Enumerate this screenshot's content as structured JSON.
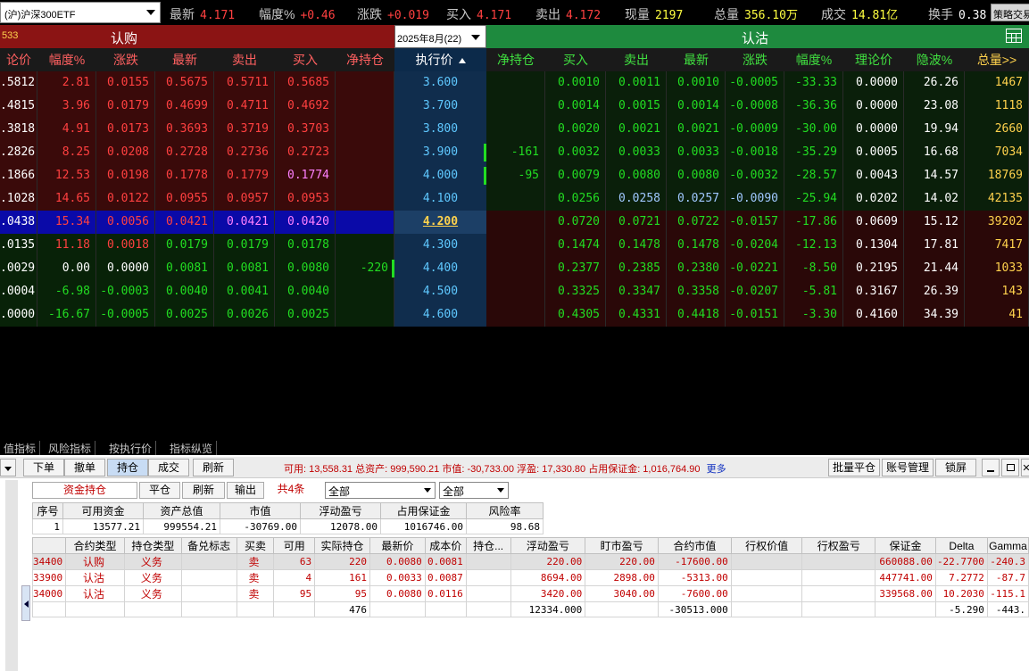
{
  "topbar": {
    "instrument": "(沪)沪深300ETF",
    "quotes": [
      {
        "label": "最新",
        "value": "4.171",
        "color": "red"
      },
      {
        "label": "幅度%",
        "value": "+0.46",
        "color": "red"
      },
      {
        "label": "涨跌",
        "value": "+0.019",
        "color": "red"
      },
      {
        "label": "买入",
        "value": "4.171",
        "color": "red"
      },
      {
        "label": "卖出",
        "value": "4.172",
        "color": "red"
      },
      {
        "label": "现量",
        "value": "2197",
        "color": "yel"
      },
      {
        "label": "总量",
        "value": "356.10万",
        "color": "yel"
      },
      {
        "label": "成交",
        "value": "14.81亿",
        "color": "yel"
      },
      {
        "label": "换手",
        "value": "0.38",
        "color": "wht"
      }
    ],
    "strategy_button": "策略交易"
  },
  "section": {
    "call_title": "认购",
    "call_num": "533",
    "month": "2025年8月(22)",
    "put_title": "认沽"
  },
  "columns": {
    "call": [
      "论价",
      "幅度%",
      "涨跌",
      "最新",
      "卖出",
      "买入",
      "净持仓"
    ],
    "strike": "执行价",
    "put": [
      "净持仓",
      "买入",
      "卖出",
      "最新",
      "涨跌",
      "幅度%",
      "理论价",
      "隐波%",
      "总量>>"
    ]
  },
  "rows": [
    {
      "call": [
        ".5812",
        "2.81",
        "0.0155",
        "0.5675",
        "0.5711",
        "0.5685",
        ""
      ],
      "strike": "3.600",
      "put": [
        "",
        "0.0010",
        "0.0011",
        "0.0010",
        "-0.0005",
        "-33.33",
        "0.0000",
        "26.26",
        "1467"
      ]
    },
    {
      "call": [
        ".4815",
        "3.96",
        "0.0179",
        "0.4699",
        "0.4711",
        "0.4692",
        ""
      ],
      "strike": "3.700",
      "put": [
        "",
        "0.0014",
        "0.0015",
        "0.0014",
        "-0.0008",
        "-36.36",
        "0.0000",
        "23.08",
        "1118"
      ]
    },
    {
      "call": [
        ".3818",
        "4.91",
        "0.0173",
        "0.3693",
        "0.3719",
        "0.3703",
        ""
      ],
      "strike": "3.800",
      "put": [
        "",
        "0.0020",
        "0.0021",
        "0.0021",
        "-0.0009",
        "-30.00",
        "0.0000",
        "19.94",
        "2660"
      ]
    },
    {
      "call": [
        ".2826",
        "8.25",
        "0.0208",
        "0.2728",
        "0.2736",
        "0.2723",
        ""
      ],
      "strike": "3.900",
      "put": [
        "-161",
        "0.0032",
        "0.0033",
        "0.0033",
        "-0.0018",
        "-35.29",
        "0.0005",
        "16.68",
        "7034"
      ]
    },
    {
      "call": [
        ".1866",
        "12.53",
        "0.0198",
        "0.1778",
        "0.1779",
        "0.1774",
        ""
      ],
      "strike": "4.000",
      "put": [
        "-95",
        "0.0079",
        "0.0080",
        "0.0080",
        "-0.0032",
        "-28.57",
        "0.0043",
        "14.57",
        "18769"
      ]
    },
    {
      "call": [
        ".1028",
        "14.65",
        "0.0122",
        "0.0955",
        "0.0957",
        "0.0953",
        ""
      ],
      "strike": "4.100",
      "put": [
        "",
        "0.0256",
        "0.0258",
        "0.0257",
        "-0.0090",
        "-25.94",
        "0.0202",
        "14.02",
        "42135"
      ]
    },
    {
      "call": [
        ".0438",
        "15.34",
        "0.0056",
        "0.0421",
        "0.0421",
        "0.0420",
        ""
      ],
      "strike": "4.200",
      "put": [
        "",
        "0.0720",
        "0.0721",
        "0.0722",
        "-0.0157",
        "-17.86",
        "0.0609",
        "15.12",
        "39202"
      ]
    },
    {
      "call": [
        ".0135",
        "11.18",
        "0.0018",
        "0.0179",
        "0.0179",
        "0.0178",
        ""
      ],
      "strike": "4.300",
      "put": [
        "",
        "0.1474",
        "0.1478",
        "0.1478",
        "-0.0204",
        "-12.13",
        "0.1304",
        "17.81",
        "7417"
      ]
    },
    {
      "call": [
        ".0029",
        "0.00",
        "0.0000",
        "0.0081",
        "0.0081",
        "0.0080",
        "-220"
      ],
      "strike": "4.400",
      "put": [
        "",
        "0.2377",
        "0.2385",
        "0.2380",
        "-0.0221",
        "-8.50",
        "0.2195",
        "21.44",
        "1033"
      ]
    },
    {
      "call": [
        ".0004",
        "-6.98",
        "-0.0003",
        "0.0040",
        "0.0041",
        "0.0040",
        ""
      ],
      "strike": "4.500",
      "put": [
        "",
        "0.3325",
        "0.3347",
        "0.3358",
        "-0.0207",
        "-5.81",
        "0.3167",
        "26.39",
        "143"
      ]
    },
    {
      "call": [
        ".0000",
        "-16.67",
        "-0.0005",
        "0.0025",
        "0.0026",
        "0.0025",
        ""
      ],
      "strike": "4.600",
      "put": [
        "",
        "0.4305",
        "0.4331",
        "0.4418",
        "-0.0151",
        "-3.30",
        "0.4160",
        "34.39",
        "41"
      ]
    }
  ],
  "lower_tabs": [
    "值指标",
    "风险指标",
    "按执行价",
    "指标纵览"
  ],
  "toolbar": {
    "buttons": [
      "下单",
      "撤单",
      "持仓",
      "成交",
      "刷新"
    ],
    "summary": "可用: 13,558.31 总资产: 999,590.21 市值: -30,733.00 浮盈: 17,330.80 占用保证金: 1,016,764.90",
    "more": "更多",
    "right_buttons": [
      "批量平仓",
      "账号管理",
      "锁屏"
    ]
  },
  "subtabs": [
    "资金持仓",
    "平仓",
    "刷新",
    "输出",
    "共4条"
  ],
  "filters": [
    "全部",
    "全部"
  ],
  "fund": {
    "headers": [
      "序号",
      "可用资金",
      "资产总值",
      "市值",
      "浮动盈亏",
      "占用保证金",
      "风险率"
    ],
    "row": [
      "1",
      "13577.21",
      "999554.21",
      "-30769.00",
      "12078.00",
      "1016746.00",
      "98.68"
    ]
  },
  "positions": {
    "headers": [
      "",
      "合约类型",
      "持仓类型",
      "备兑标志",
      "买卖",
      "可用",
      "实际持仓",
      "最新价",
      "成本价",
      "持仓...",
      "浮动盈亏",
      "盯市盈亏",
      "合约市值",
      "行权价值",
      "行权盈亏",
      "保证金",
      "Delta",
      "Gamma"
    ],
    "rows": [
      [
        "34400",
        "认购",
        "义务",
        "",
        "卖",
        "63",
        "220",
        "0.0080",
        "0.0081",
        "",
        "220.00",
        "220.00",
        "-17600.00",
        "",
        "",
        "660088.00",
        "-22.7700",
        "-240.3"
      ],
      [
        "33900",
        "认沽",
        "义务",
        "",
        "卖",
        "4",
        "161",
        "0.0033",
        "0.0087",
        "",
        "8694.00",
        "2898.00",
        "-5313.00",
        "",
        "",
        "447741.00",
        "7.2772",
        "-87.7"
      ],
      [
        "34000",
        "认沽",
        "义务",
        "",
        "卖",
        "95",
        "95",
        "0.0080",
        "0.0116",
        "",
        "3420.00",
        "3040.00",
        "-7600.00",
        "",
        "",
        "339568.00",
        "10.2030",
        "-115.1"
      ]
    ],
    "total": [
      "",
      "",
      "",
      "",
      "",
      "",
      "476",
      "",
      "",
      "",
      "12334.000",
      "",
      "-30513.000",
      "",
      "",
      "",
      "-5.290",
      "-443."
    ]
  }
}
